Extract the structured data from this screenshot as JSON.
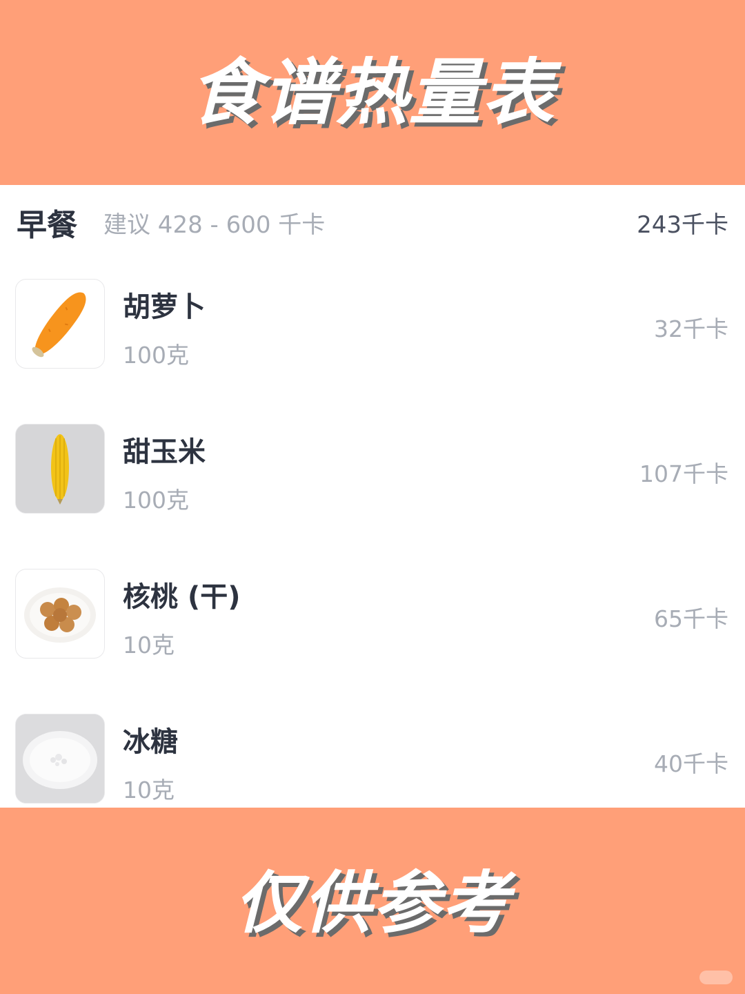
{
  "banner": {
    "title": "食谱热量表"
  },
  "footer": {
    "title": "仅供参考"
  },
  "meal": {
    "name": "早餐",
    "suggestion": "建议 428 - 600 千卡",
    "total": "243千卡"
  },
  "foods": [
    {
      "name": "胡萝卜",
      "amount": "100克",
      "kcal": "32千卡",
      "icon": "carrot-icon"
    },
    {
      "name": "甜玉米",
      "amount": "100克",
      "kcal": "107千卡",
      "icon": "corn-icon"
    },
    {
      "name": "核桃 (干)",
      "amount": "10克",
      "kcal": "65千卡",
      "icon": "walnut-icon"
    },
    {
      "name": "冰糖",
      "amount": "10克",
      "kcal": "40千卡",
      "icon": "rock-sugar-icon"
    }
  ],
  "colors": {
    "banner": "#ff9f78",
    "title_text": "#ffffff",
    "muted_text": "#a7acb5",
    "dark_text": "#2d3340"
  }
}
